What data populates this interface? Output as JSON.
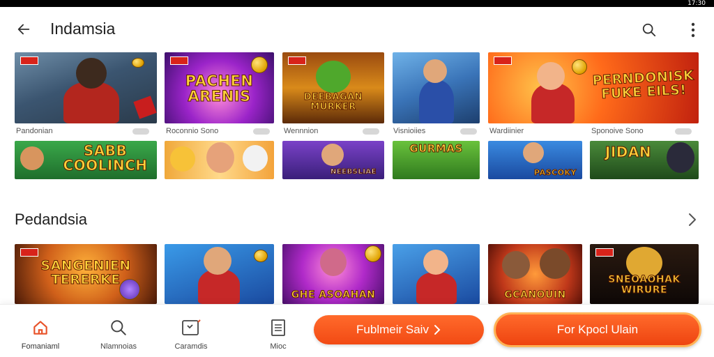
{
  "status_bar": {
    "time": "17:30"
  },
  "app_bar": {
    "title": "Indamsia",
    "back_icon": "arrow-left-icon",
    "search_icon": "search-icon",
    "more_icon": "more-vertical-icon"
  },
  "row1": [
    {
      "title": "",
      "caption": "Pandonian"
    },
    {
      "title": "PACHEN ARENIS",
      "caption": "Roconnio Sono"
    },
    {
      "title": "DEEBAGAN MURKER",
      "caption": "Wennnion"
    },
    {
      "title": "",
      "caption": "Visnioiies"
    },
    {
      "title": "PERNDONISK FUKE EILS!",
      "caption": "Wardiinier"
    },
    {
      "caption": "Sponoive Sono"
    }
  ],
  "row2": [
    {
      "title": "SABB COOLINCH"
    },
    {
      "title": ""
    },
    {
      "title": "NEEBSLIAE"
    },
    {
      "title": "GURMAS"
    },
    {
      "title": "PASCOKY"
    },
    {
      "title": "JIDAN"
    }
  ],
  "section2": {
    "title": "Pedandsia",
    "chevron_icon": "chevron-right-icon",
    "tiles": [
      {
        "title": "SANGENIEN TERERKE"
      },
      {
        "title": ""
      },
      {
        "title": "GHE ASOAHAN"
      },
      {
        "title": ""
      },
      {
        "title": "GCANOUIN"
      },
      {
        "title": "SNEOAOHAK WIRURE"
      }
    ]
  },
  "bottom_nav": {
    "items": [
      {
        "label": "Fomaniaml",
        "icon": "home-icon"
      },
      {
        "label": "Nlamnoias",
        "icon": "search-icon"
      },
      {
        "label": "Caramdis",
        "icon": "game-card-icon"
      },
      {
        "label": "Mioc",
        "icon": "list-icon"
      }
    ],
    "primary_button": "Fublmeir Saiv",
    "secondary_button": "For Kpocl Ulain"
  },
  "colors": {
    "accent": "#f24a14",
    "accent_border": "#ffb255",
    "nav_active": "#e8532a"
  }
}
